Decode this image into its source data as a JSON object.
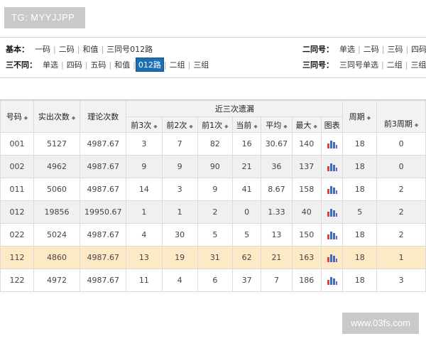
{
  "badge": "TG: MYYJJPP",
  "watermark": "www.03fs.com",
  "filters": {
    "basic": {
      "label": "基本：",
      "options": [
        "一码",
        "二码",
        "和值",
        "三同号012路"
      ]
    },
    "diff": {
      "label": "三不同：",
      "options": [
        "单选",
        "四码",
        "五码",
        "和值",
        "012路",
        "二组",
        "三组"
      ],
      "active": "012路"
    },
    "same2": {
      "label": "二同号：",
      "options": [
        "单选",
        "二码",
        "三码",
        "四码"
      ]
    },
    "same3": {
      "label": "三同号：",
      "options": [
        "三同号单选",
        "二组",
        "三组"
      ]
    }
  },
  "table": {
    "headers": {
      "number": "号码",
      "appear": "实出次数",
      "theory": "理论次数",
      "recent_group": "近三次遗漏",
      "period": "周期",
      "prev3_period": "前3周期",
      "sub": [
        "前3次",
        "前2次",
        "前1次",
        "当前",
        "平均",
        "最大",
        "图表"
      ]
    },
    "rows": [
      [
        "001",
        "5127",
        "4987.67",
        "3",
        "7",
        "82",
        "16",
        "30.67",
        "140",
        "18",
        "0"
      ],
      [
        "002",
        "4962",
        "4987.67",
        "9",
        "9",
        "90",
        "21",
        "36",
        "137",
        "18",
        "0"
      ],
      [
        "011",
        "5060",
        "4987.67",
        "14",
        "3",
        "9",
        "41",
        "8.67",
        "158",
        "18",
        "2"
      ],
      [
        "012",
        "19856",
        "19950.67",
        "1",
        "1",
        "2",
        "0",
        "1.33",
        "40",
        "5",
        "2"
      ],
      [
        "022",
        "5024",
        "4987.67",
        "4",
        "30",
        "5",
        "5",
        "13",
        "150",
        "18",
        "2"
      ],
      [
        "112",
        "4860",
        "4987.67",
        "13",
        "19",
        "31",
        "62",
        "21",
        "163",
        "18",
        "1"
      ],
      [
        "122",
        "4972",
        "4987.67",
        "11",
        "4",
        "6",
        "37",
        "7",
        "186",
        "18",
        "3"
      ]
    ],
    "highlight_row": 5
  },
  "colors": {
    "accent": "#1c6fb5",
    "highlight": "#fde9c6"
  }
}
